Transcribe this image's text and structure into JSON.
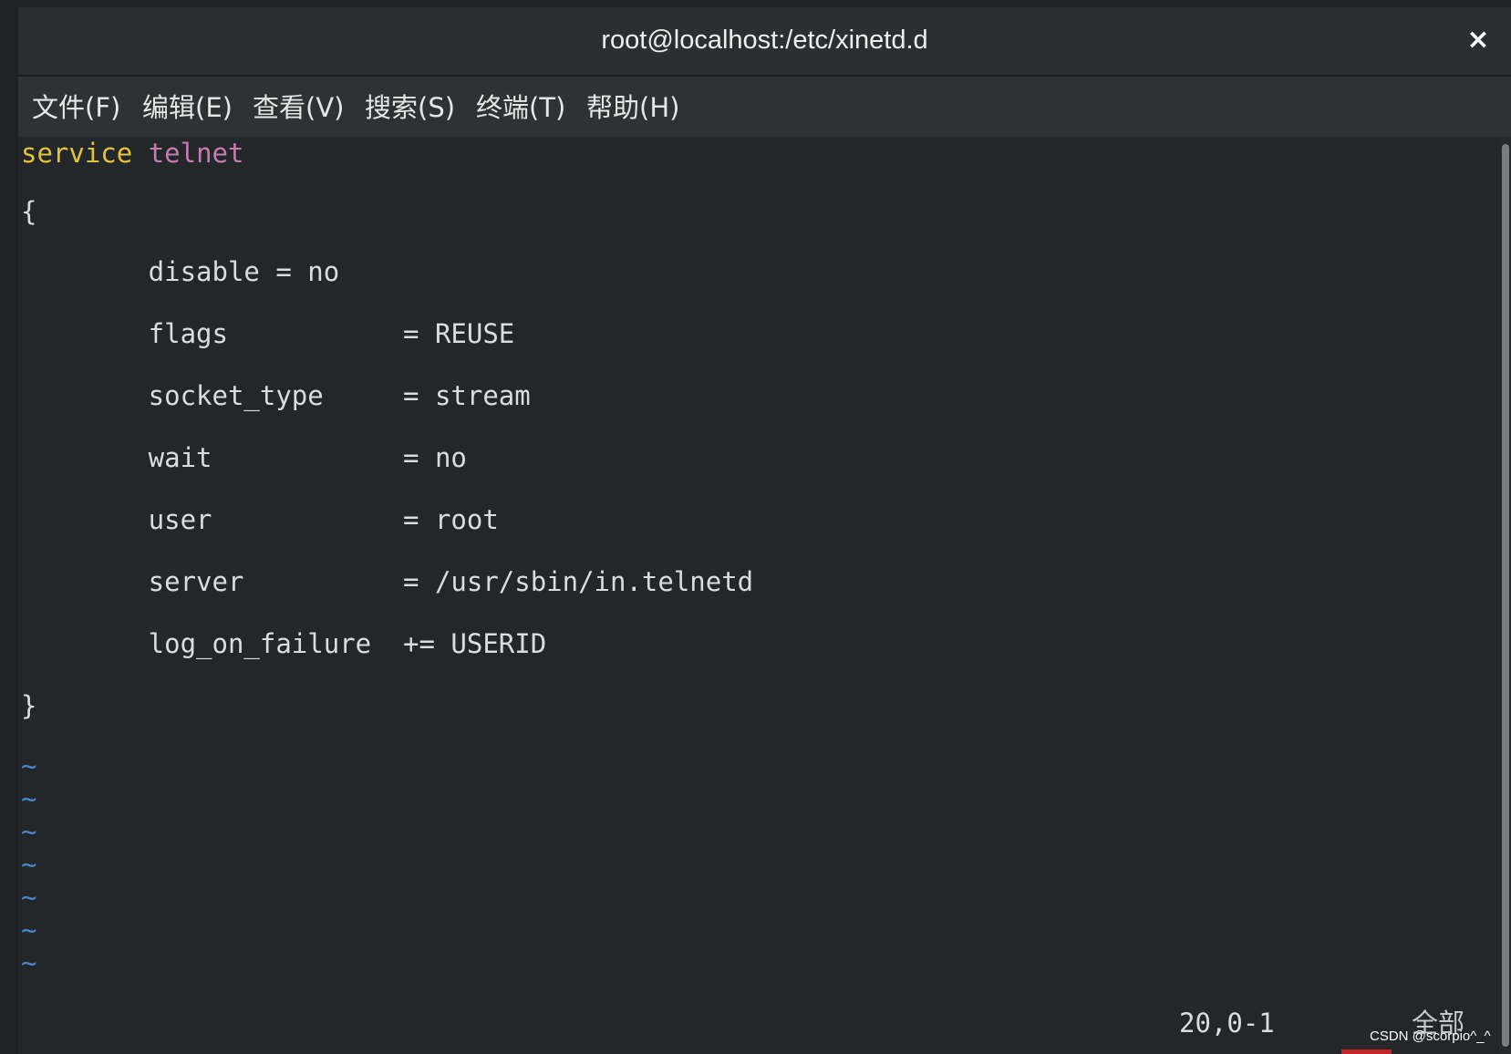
{
  "window": {
    "title": "root@localhost:/etc/xinetd.d",
    "close_label": "×"
  },
  "menu": {
    "items": [
      {
        "label": "文件(F)"
      },
      {
        "label": "编辑(E)"
      },
      {
        "label": "查看(V)"
      },
      {
        "label": "搜索(S)"
      },
      {
        "label": "终端(T)"
      },
      {
        "label": "帮助(H)"
      }
    ]
  },
  "editor": {
    "keyword": "service",
    "service_name": "telnet",
    "open_brace": "{",
    "close_brace": "}",
    "lines": [
      "        disable = no",
      "        flags           = REUSE",
      "        socket_type     = stream",
      "        wait            = no",
      "        user            = root",
      "        server          = /usr/sbin/in.telnetd",
      "        log_on_failure  += USERID"
    ],
    "tilde": "~"
  },
  "status": {
    "position": "20,0-1",
    "scope": "全部"
  },
  "watermark": "CSDN @scorpio^_^",
  "colors": {
    "keyword": "#e3c33a",
    "service_name": "#c57bb0",
    "tilde": "#4c85c9",
    "background": "#232729"
  }
}
